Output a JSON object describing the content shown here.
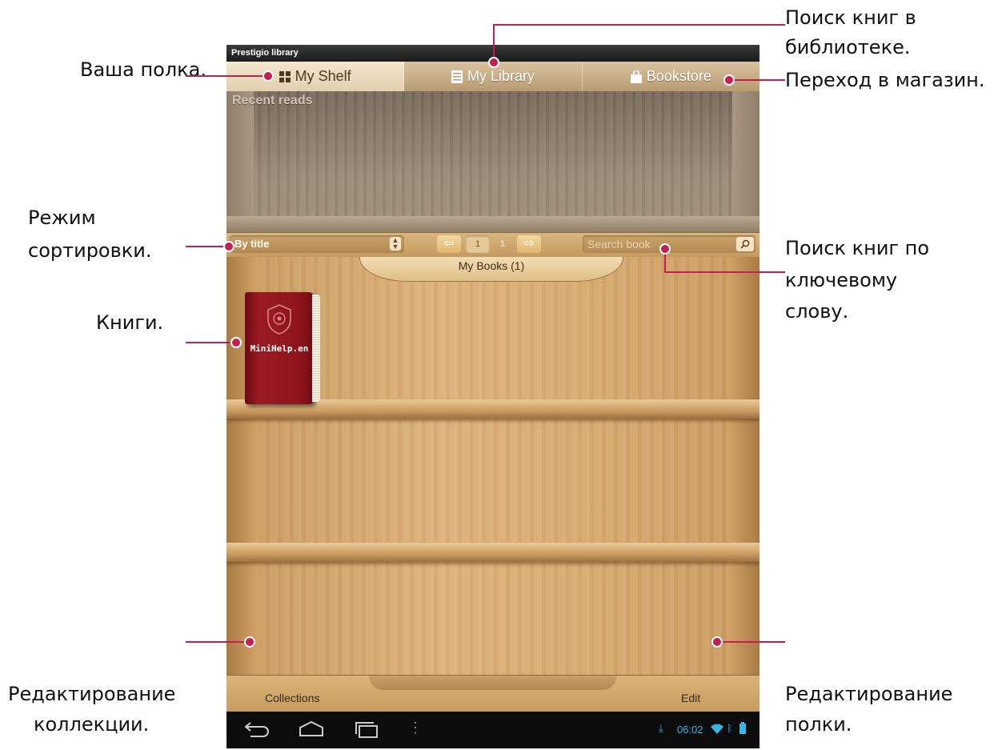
{
  "app": {
    "window_title": "Prestigio library",
    "tabs": [
      {
        "label": "My Shelf",
        "active": true
      },
      {
        "label": "My Library",
        "active": false
      },
      {
        "label": "Bookstore",
        "active": false
      }
    ],
    "recent_reads_label": "Recent reads",
    "sort": {
      "value": "By title"
    },
    "pager": {
      "current": "1",
      "total": "1"
    },
    "search": {
      "placeholder": "Search book"
    },
    "shelf_label": "My Books (1)",
    "books": [
      {
        "title": "MiniHelp.en"
      }
    ],
    "bottom": {
      "collections_label": "Collections",
      "edit_label": "Edit"
    },
    "system": {
      "time": "06:02"
    }
  },
  "annotations": {
    "shelf": "Ваша полка.",
    "library_search_1": "Поиск книг в",
    "library_search_2": "библиотеке.",
    "store": "Переход в магазин.",
    "sort_1": "Режим",
    "sort_2": "сортировки.",
    "keyword_1": "Поиск книг по",
    "keyword_2": "ключевому",
    "keyword_3": "слову.",
    "books": "Книги.",
    "coll_edit_1": "Редактирование",
    "coll_edit_2": "коллекции.",
    "shelf_edit_1": "Редактирование",
    "shelf_edit_2": "полки."
  },
  "colors": {
    "callout": "#c4204f",
    "accent_blue": "#33b5e5"
  },
  "icons": [
    "grid-icon",
    "list-icon",
    "bag-icon",
    "spinner-icon",
    "arrow-left-icon",
    "arrow-right-icon",
    "search-icon",
    "back-icon",
    "home-icon",
    "recents-icon",
    "menu-dots-icon",
    "download-icon",
    "wifi-icon",
    "bluetooth-icon",
    "battery-icon"
  ]
}
